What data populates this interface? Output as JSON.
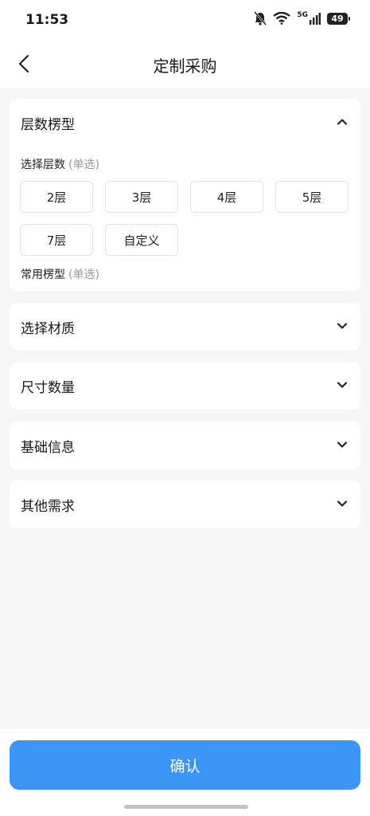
{
  "status_bar": {
    "time": "11:53",
    "network": "5G",
    "battery": "49"
  },
  "nav": {
    "title": "定制采购"
  },
  "sections": [
    {
      "title": "层数楞型",
      "expanded": true
    },
    {
      "title": "选择材质",
      "expanded": false
    },
    {
      "title": "尺寸数量",
      "expanded": false
    },
    {
      "title": "基础信息",
      "expanded": false
    },
    {
      "title": "其他需求",
      "expanded": false
    }
  ],
  "layers": {
    "label": "选择层数",
    "hint": "(单选)",
    "options": [
      "2层",
      "3层",
      "4层",
      "5层",
      "7层",
      "自定义"
    ]
  },
  "flute": {
    "label": "常用楞型",
    "hint": "(单选)"
  },
  "footer": {
    "confirm_label": "确认"
  }
}
